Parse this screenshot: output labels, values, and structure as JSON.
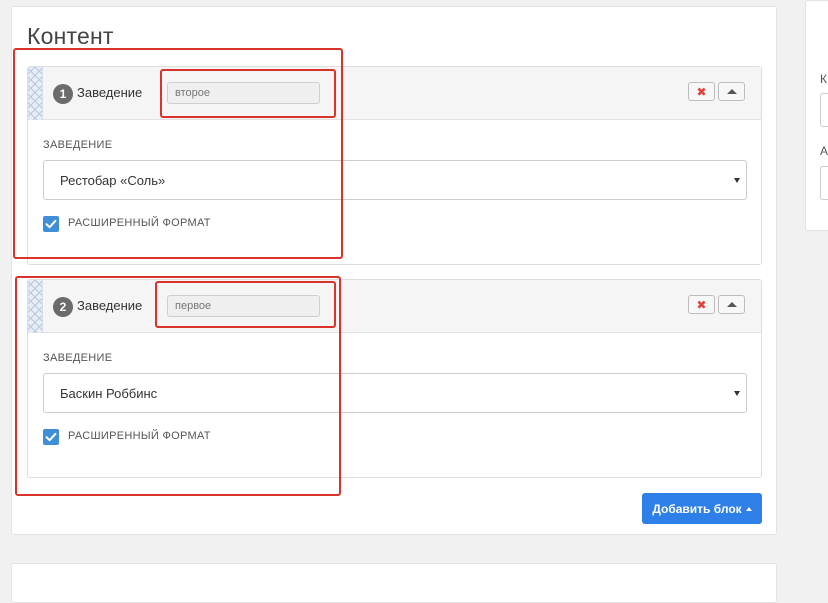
{
  "content": {
    "title": "Контент",
    "blocks": [
      {
        "number": "1",
        "label": "Заведение",
        "name_value": "второе",
        "field_label": "ЗАВЕДЕНИЕ",
        "selected": "Рестобар «Соль»",
        "checkbox_label": "РАСШИРЕННЫЙ ФОРМАТ",
        "checked": true
      },
      {
        "number": "2",
        "label": "Заведение",
        "name_value": "первое",
        "field_label": "ЗАВЕДЕНИЕ",
        "selected": "Баскин Роббинс",
        "checkbox_label": "РАСШИРЕННЫЙ ФОРМАТ",
        "checked": true
      }
    ],
    "add_button_label": "Добавить блок"
  },
  "sidebar": {
    "letters": [
      "К",
      "А"
    ]
  },
  "icons": {
    "delete": "close-icon",
    "collapse": "chevron-up-icon",
    "checkbox": "check-icon",
    "handle": "drag-handle-icon"
  },
  "colors": {
    "accent": "#2f7fe8",
    "checkbox": "#3f8ed8",
    "delete_icon": "#e0413b",
    "annotation": "#d8342c"
  }
}
